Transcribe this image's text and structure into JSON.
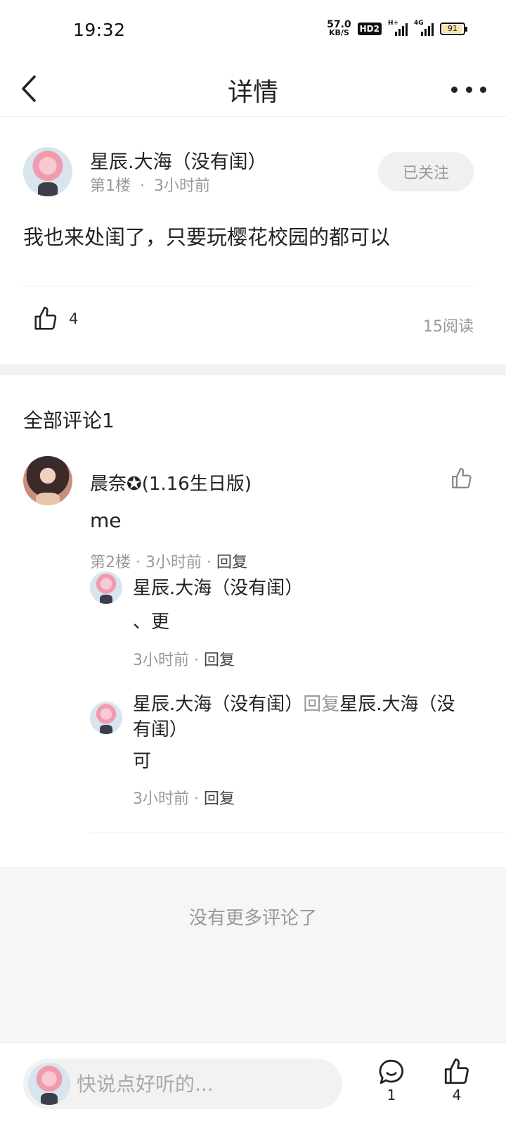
{
  "status_bar": {
    "time": "19:32",
    "net_speed": "57.0",
    "net_unit": "KB/S",
    "hd_label": "HD2",
    "signal1_label": "H+",
    "signal2_label": "4G",
    "battery": "91"
  },
  "nav": {
    "title": "详情"
  },
  "post": {
    "author": "星辰.大海（没有闺）",
    "floor": "第1楼",
    "dot": "·",
    "time": "3小时前",
    "follow_label": "已关注",
    "content": "我也来处闺了，只要玩樱花校园的都可以",
    "like_count": "4",
    "read_count": "15阅读"
  },
  "comments": {
    "title": "全部评论1",
    "items": [
      {
        "author": "晨奈✪(1.16生日版)",
        "text": "me",
        "meta": "第2楼 · 3小时前 · ",
        "reply_label": "回复",
        "replies": [
          {
            "author": "星辰.大海（没有闺）",
            "text": "、更",
            "meta": "3小时前 · ",
            "reply_label": "回复"
          },
          {
            "author": "星辰.大海（没有闺）",
            "reply_word": "回复",
            "target_line1": "星辰.大海（没",
            "target_line2": "有闺）",
            "text": "可",
            "meta": "3小时前 · ",
            "reply_label": "回复"
          }
        ]
      }
    ],
    "no_more": "没有更多评论了"
  },
  "bottom_bar": {
    "input_placeholder": "快说点好听的...",
    "comment_count": "1",
    "like_count": "4"
  },
  "colors": {
    "text": "#222222",
    "muted": "#999999",
    "divider": "#eeeeee",
    "panel": "#f6f6f6"
  }
}
